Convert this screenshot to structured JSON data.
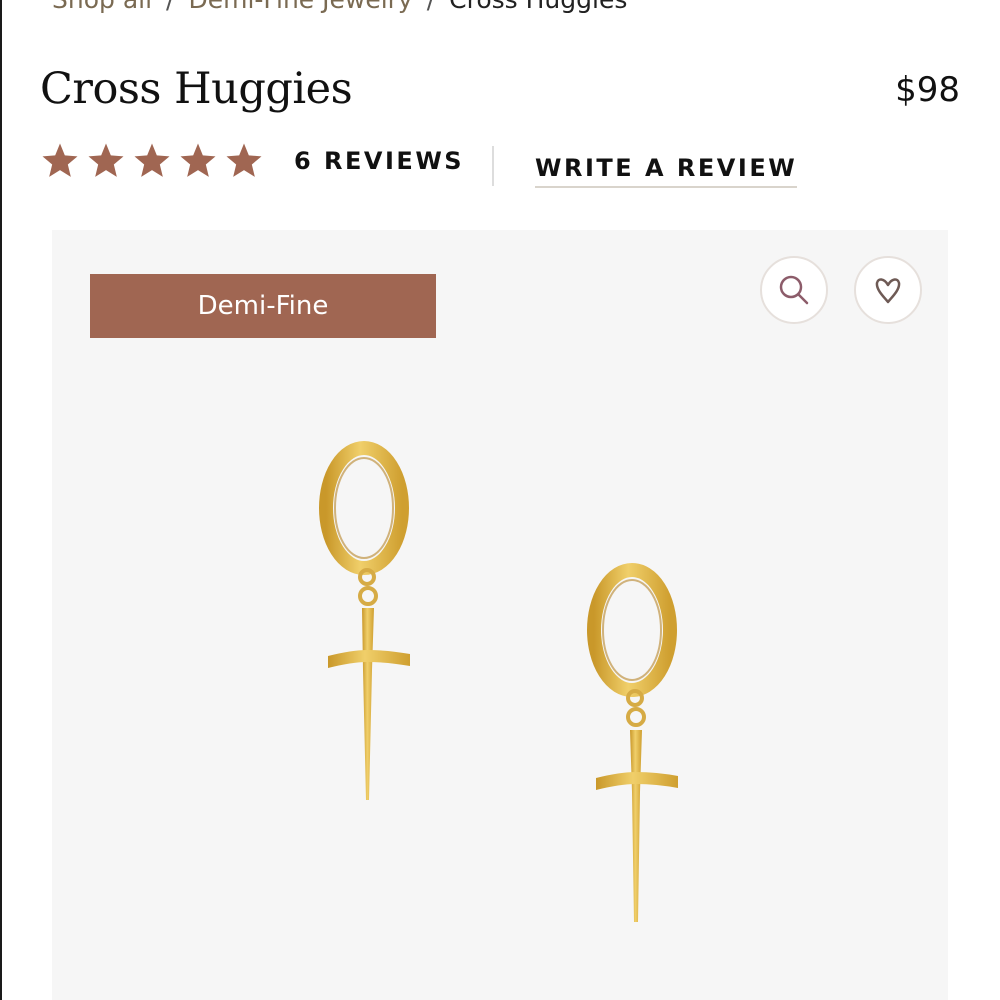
{
  "breadcrumb": {
    "items": [
      "Shop all",
      "Demi-Fine Jewelry"
    ],
    "separator": "/",
    "current": "Cross Huggies"
  },
  "product": {
    "title": "Cross Huggies",
    "price": "$98",
    "rating_stars": 5,
    "reviews_label": "6 REVIEWS",
    "write_review_label": "WRITE A REVIEW"
  },
  "image": {
    "badge": "Demi-Fine",
    "zoom_icon": "search-icon",
    "wishlist_icon": "heart-icon"
  },
  "colors": {
    "accent": "#a06652",
    "star": "#a06652",
    "gold": "#e0b84a",
    "panel_bg": "#f6f6f6"
  }
}
